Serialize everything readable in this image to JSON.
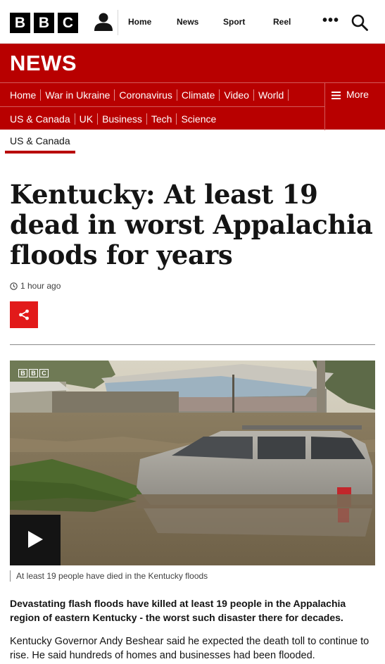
{
  "header": {
    "logo_letters": [
      "B",
      "B",
      "C"
    ],
    "nav": [
      "Home",
      "News",
      "Sport",
      "Reel"
    ],
    "more": "•••"
  },
  "section": {
    "title": "NEWS",
    "nav_row1": [
      "Home",
      "War in Ukraine",
      "Coronavirus",
      "Climate",
      "Video",
      "World"
    ],
    "nav_row2": [
      "US & Canada",
      "UK",
      "Business",
      "Tech",
      "Science"
    ],
    "more_label": "More"
  },
  "subnav": {
    "active": "US & Canada"
  },
  "article": {
    "headline": "Kentucky: At least 19 dead in worst Appalachia floods for years",
    "timestamp": "1 hour ago",
    "media_logo": [
      "B",
      "B",
      "C"
    ],
    "caption": "At least 19 people have died in the Kentucky floods",
    "lead": "Devastating flash floods have killed at least 19 people in the Appalachia region of eastern Kentucky - the worst such disaster there for decades.",
    "paragraph1": "Kentucky Governor Andy Beshear said he expected the death toll to continue to rise. He said hundreds of homes and businesses had been flooded."
  },
  "colors": {
    "brand_red": "#b80000",
    "share_red": "#e21a1a"
  }
}
